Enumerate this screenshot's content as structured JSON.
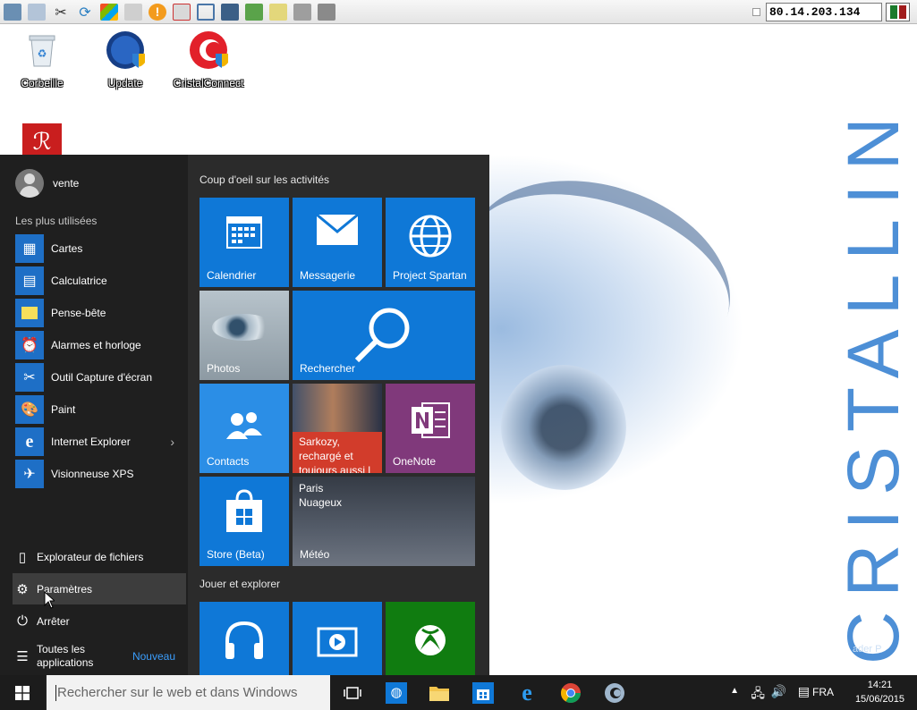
{
  "rdp_toolbar": {
    "ip_address": "80.14.203.134"
  },
  "desktop": {
    "brand": "CRISTALLIN",
    "brand_partial": "ader P",
    "icons": [
      {
        "label": "Corbeille",
        "icon": "recycle-bin-icon"
      },
      {
        "label": "Update",
        "icon": "globe-shield-icon"
      },
      {
        "label": "CristalConnect",
        "icon": "cristal-connect-icon"
      },
      {
        "label": "",
        "icon": "adobe-reader-icon"
      }
    ]
  },
  "start_menu": {
    "user_name": "vente",
    "most_used_header": "Les plus utilisées",
    "apps": [
      {
        "label": "Cartes",
        "icon": "maps-icon"
      },
      {
        "label": "Calculatrice",
        "icon": "calculator-icon"
      },
      {
        "label": "Pense-bête",
        "icon": "sticky-notes-icon"
      },
      {
        "label": "Alarmes et horloge",
        "icon": "alarm-clock-icon"
      },
      {
        "label": "Outil Capture d'écran",
        "icon": "snipping-tool-icon"
      },
      {
        "label": "Paint",
        "icon": "paint-icon"
      },
      {
        "label": "Internet Explorer",
        "icon": "internet-explorer-icon",
        "has_submenu": true
      },
      {
        "label": "Visionneuse XPS",
        "icon": "xps-viewer-icon"
      }
    ],
    "system": [
      {
        "label": "Explorateur de fichiers",
        "icon": "file-explorer-icon"
      },
      {
        "label": "Paramètres",
        "icon": "settings-gear-icon",
        "selected": true
      },
      {
        "label": "Arrêter",
        "icon": "power-icon"
      },
      {
        "label": "Toutes les applications",
        "icon": "all-apps-icon",
        "badge": "Nouveau"
      }
    ],
    "group1_title": "Coup d'oeil sur les activités",
    "group2_title": "Jouer et explorer",
    "tiles": {
      "calendrier": "Calendrier",
      "messagerie": "Messagerie",
      "project_spartan": "Project Spartan",
      "photos": "Photos",
      "rechercher": "Rechercher",
      "contacts": "Contacts",
      "news_headline": "Sarkozy, rechargé et toujours aussi l",
      "onenote": "OneNote",
      "store": "Store (Beta)",
      "meteo_city": "Paris",
      "meteo_cond": "Nuageux",
      "meteo": "Météo"
    },
    "colors": {
      "tile_blue": "#0f78d7",
      "tile_light_blue": "#2b8ee6",
      "onenote_purple": "#80397b",
      "xbox_green": "#107c10",
      "news_red": "#d23c2b"
    }
  },
  "taskbar": {
    "search_placeholder": "Rechercher sur le web et dans Windows",
    "language": "FRA",
    "time": "14:21",
    "date": "15/06/2015",
    "pinned": [
      "task-view-icon",
      "network-globe-icon",
      "file-explorer-icon",
      "store-icon",
      "internet-explorer-icon",
      "chrome-icon",
      "cristal-connect-icon"
    ]
  }
}
